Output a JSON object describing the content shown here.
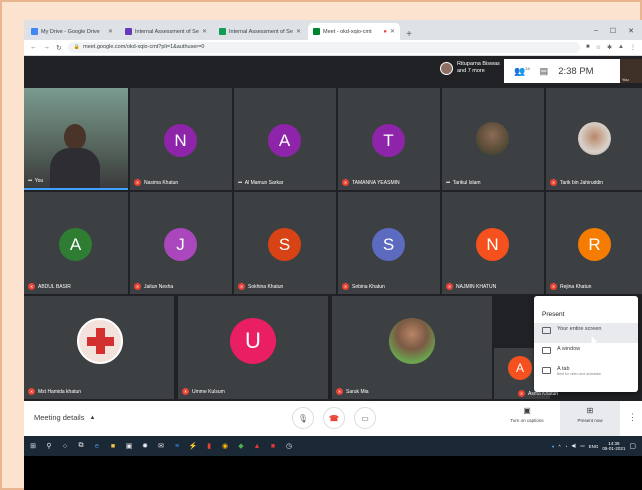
{
  "browser": {
    "tabs": [
      {
        "title": "My Drive - Google Drive",
        "color": "#4285f4",
        "active": false
      },
      {
        "title": "Internal Assessment of Semester",
        "color": "#673ab7",
        "active": false
      },
      {
        "title": "Internal Assessment of Semester",
        "color": "#0f9d58",
        "active": false
      },
      {
        "title": "Meet - okd-xqio-cmt",
        "color": "#00832d",
        "active": true
      }
    ],
    "url": "meet.google.com/okd-xqio-cmt?pli=1&authuser=0"
  },
  "meet": {
    "others_label_1": "Rituparna Biswas",
    "others_label_2": "and 7 more",
    "people_count": "24",
    "time": "2:38 PM",
    "self_thumb_label": "You"
  },
  "participants": [
    {
      "name": "You",
      "letter": "",
      "color": "",
      "muted": false,
      "type": "video"
    },
    {
      "name": "Nasima Khatun",
      "letter": "N",
      "color": "#8e24aa",
      "muted": true,
      "type": "letter"
    },
    {
      "name": "Al Mamun Sarkar",
      "letter": "A",
      "color": "#8e24aa",
      "muted": false,
      "type": "letter"
    },
    {
      "name": "TAMANNA YEASMIN",
      "letter": "T",
      "color": "#8e24aa",
      "muted": true,
      "type": "letter"
    },
    {
      "name": "Tarikul Islam",
      "letter": "",
      "color": "#5d4e3a",
      "muted": false,
      "type": "photo"
    },
    {
      "name": "Tarik bin Jahiruddin",
      "letter": "",
      "color": "#c9c0b6",
      "muted": true,
      "type": "photo"
    },
    {
      "name": "ABDUL BASIR",
      "letter": "A",
      "color": "#2e7d32",
      "muted": true,
      "type": "letter"
    },
    {
      "name": "Jaitun Nesha",
      "letter": "J",
      "color": "#ab47bc",
      "muted": true,
      "type": "letter"
    },
    {
      "name": "Sokhina Khatun",
      "letter": "S",
      "color": "#d84315",
      "muted": true,
      "type": "letter"
    },
    {
      "name": "Sebina Khatun",
      "letter": "S",
      "color": "#5c6bc0",
      "muted": true,
      "type": "letter"
    },
    {
      "name": "NAJMIN KHATUN",
      "letter": "N",
      "color": "#f4511e",
      "muted": true,
      "type": "letter"
    },
    {
      "name": "Rejina Khatun",
      "letter": "R",
      "color": "#f57c00",
      "muted": true,
      "type": "letter"
    },
    {
      "name": "Mst Hamida khatun",
      "letter": "",
      "color": "#f3e1dc",
      "muted": true,
      "type": "photo"
    },
    {
      "name": "Umme Kulsum",
      "letter": "U",
      "color": "#e91e63",
      "muted": true,
      "type": "letter"
    },
    {
      "name": "Saruk Mia",
      "letter": "",
      "color": "#7b5a44",
      "muted": true,
      "type": "photo"
    },
    {
      "name": "Asma Khatun",
      "letter": "A",
      "color": "#f4511e",
      "muted": true,
      "type": "letter"
    }
  ],
  "present_menu": {
    "title": "Present",
    "items": [
      {
        "label": "Your entire screen",
        "sub": ""
      },
      {
        "label": "A window",
        "sub": ""
      },
      {
        "label": "A tab",
        "sub": "Best for video and animation"
      }
    ]
  },
  "controls": {
    "meeting_details": "Meeting details",
    "captions": "Turn on captions",
    "present_now": "Present now"
  },
  "taskbar": {
    "lang": "ENG",
    "time": "14:38",
    "date": "05-01-2021"
  }
}
